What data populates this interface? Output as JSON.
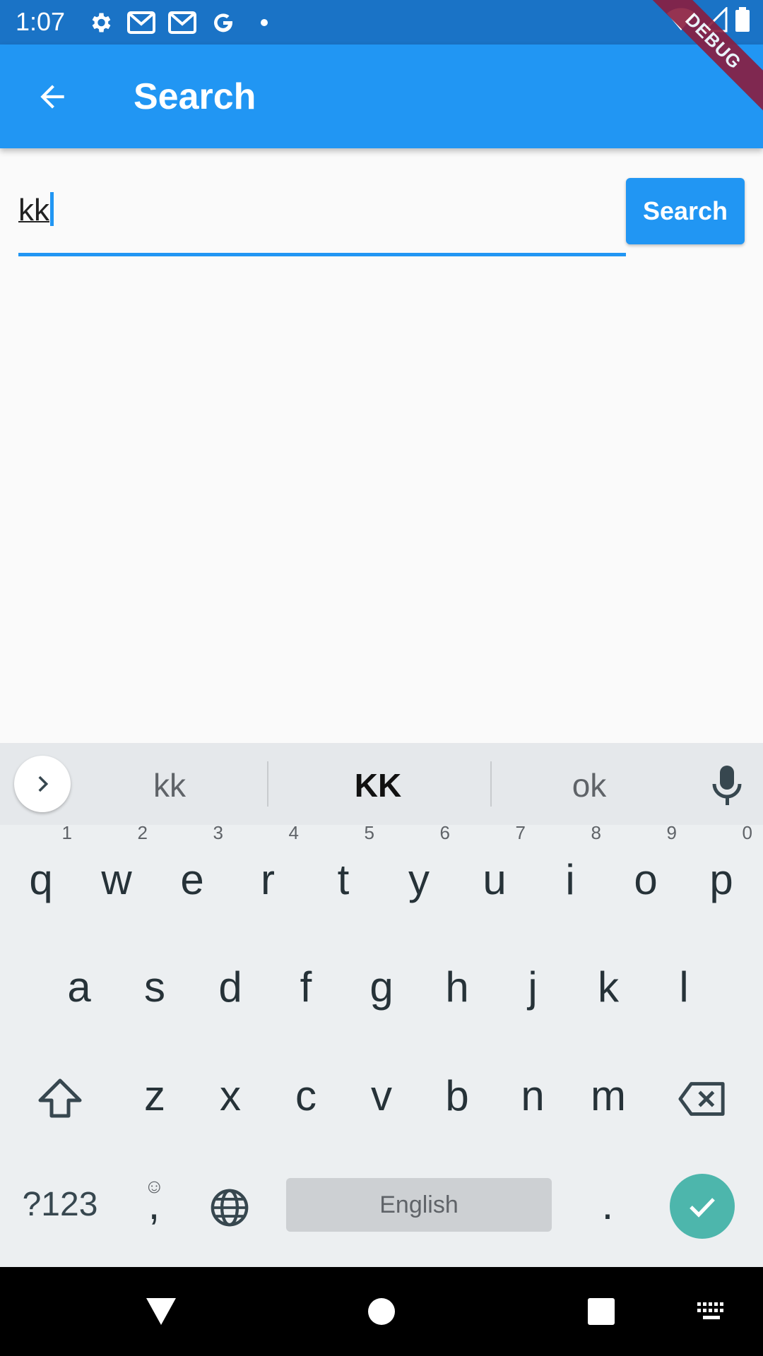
{
  "status_bar": {
    "time": "1:07",
    "icons": [
      "gear-icon",
      "gmail-icon",
      "gmail-icon",
      "google-icon",
      "dot-icon"
    ],
    "right_icons": [
      "wifi-icon",
      "signal-icon",
      "battery-icon"
    ]
  },
  "debug_banner": {
    "text": "DEBUG"
  },
  "app_bar": {
    "title": "Search",
    "color": "#2196f3"
  },
  "search": {
    "value": "kk",
    "button_label": "Search"
  },
  "keyboard": {
    "suggestions": [
      "kk",
      "KK",
      "ok"
    ],
    "row1": [
      {
        "key": "q",
        "hint": "1"
      },
      {
        "key": "w",
        "hint": "2"
      },
      {
        "key": "e",
        "hint": "3"
      },
      {
        "key": "r",
        "hint": "4"
      },
      {
        "key": "t",
        "hint": "5"
      },
      {
        "key": "y",
        "hint": "6"
      },
      {
        "key": "u",
        "hint": "7"
      },
      {
        "key": "i",
        "hint": "8"
      },
      {
        "key": "o",
        "hint": "9"
      },
      {
        "key": "p",
        "hint": "0"
      }
    ],
    "row2": [
      "a",
      "s",
      "d",
      "f",
      "g",
      "h",
      "j",
      "k",
      "l"
    ],
    "row3": [
      "z",
      "x",
      "c",
      "v",
      "b",
      "n",
      "m"
    ],
    "symbols_key": "?123",
    "comma_key": ",",
    "space_label": "English",
    "period_key": ".",
    "accent": "#4db6ac"
  }
}
